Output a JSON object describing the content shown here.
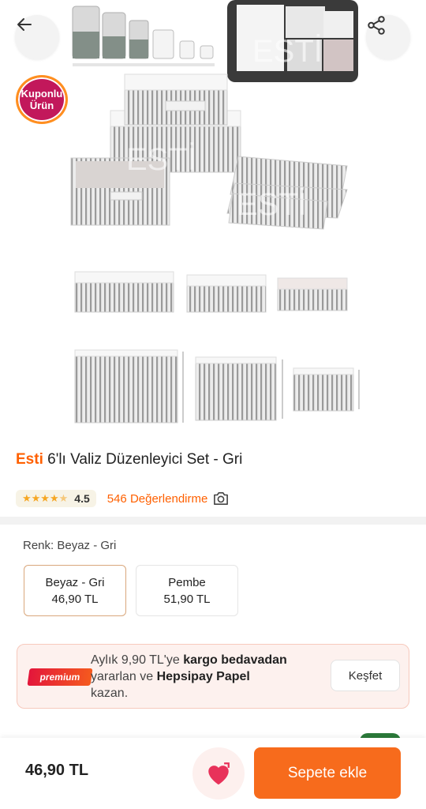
{
  "hero": {
    "coupon_line1": "Kuponlu",
    "coupon_line2": "Ürün",
    "watermark": "ESTİ"
  },
  "product": {
    "brand": "Esti",
    "name": "6'lı Valiz Düzenleyici Set - Gri",
    "rating": "4.5",
    "stars": 4.5,
    "review_count_text": "546 Değerlendirme"
  },
  "variants": {
    "label": "Renk: Beyaz - Gri",
    "options": [
      {
        "name": "Beyaz - Gri",
        "price": "46,90 TL",
        "selected": true
      },
      {
        "name": "Pembe",
        "price": "51,90 TL",
        "selected": false
      }
    ]
  },
  "premium": {
    "badge": "premium",
    "text_1": "Aylık 9,90 TL'ye ",
    "text_bold_1": "kargo bedavadan",
    "text_2": "yararlan ve ",
    "text_bold_2": "Hepsipay Papel",
    "text_3": "kazan.",
    "button": "Keşfet"
  },
  "bottom_bar": {
    "price": "46,90 TL",
    "cart_button": "Sepete ekle"
  },
  "colors": {
    "brand_orange": "#ff6000",
    "cart_button": "#f76b1c",
    "star": "#f6a623"
  },
  "icons": [
    "arrow-left-icon",
    "share-icon",
    "star-icon",
    "camera-icon",
    "heart-icon"
  ]
}
